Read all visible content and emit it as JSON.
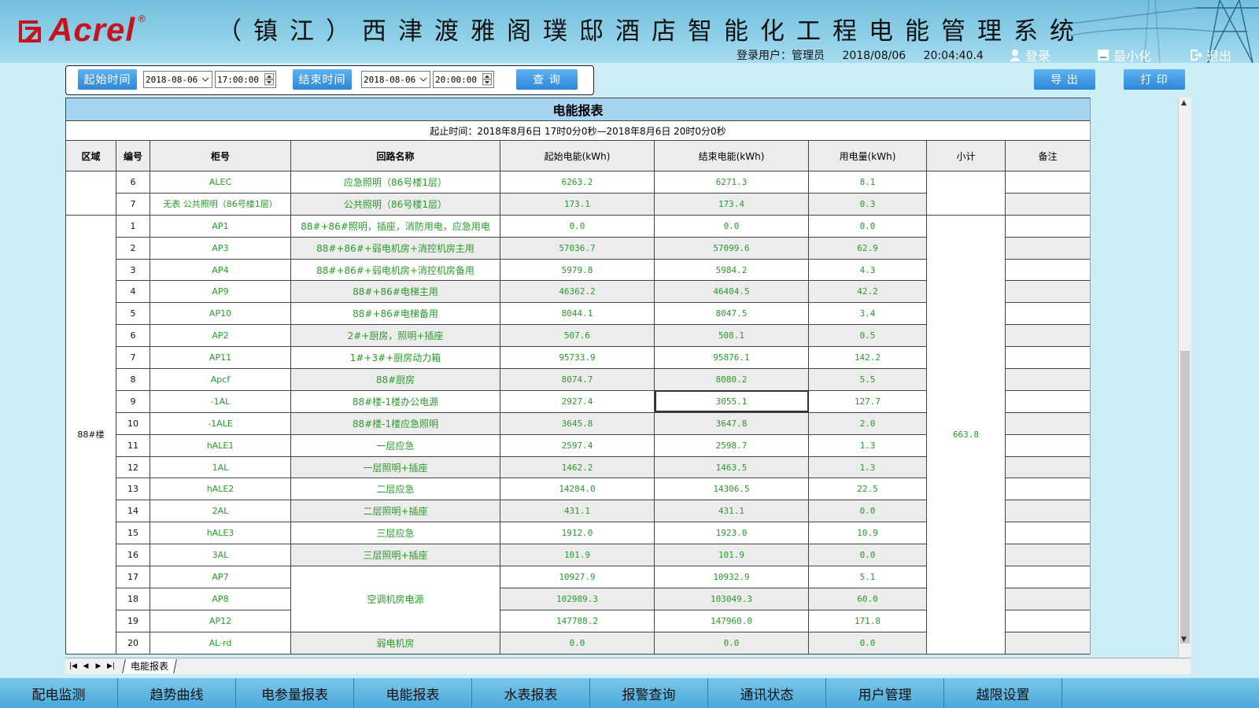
{
  "header": {
    "logo_text": "Acrel",
    "logo_reg": "®",
    "title": "（镇江）西津渡雅阁璞邸酒店智能化工程电能管理系统",
    "user_label": "登录用户：",
    "user_name": "管理员",
    "date": "2018/08/06",
    "time": "20:04:40.4",
    "login": "登录",
    "minimize": "最小化",
    "exit": "退出"
  },
  "toolbar": {
    "start_label": "起始时间",
    "start_date": "2018-08-06",
    "start_time": "17:00:00",
    "end_label": "结束时间",
    "end_date": "2018-08-06",
    "end_time": "20:00:00",
    "query": "查 询",
    "export": "导 出",
    "print": "打 印"
  },
  "report": {
    "title": "电能报表",
    "period": "起止时间：2018年8月6日 17时0分0秒—2018年8月6日 20时0分0秒",
    "columns": [
      "区域",
      "编号",
      "柜号",
      "回路名称",
      "起始电能(kWh)",
      "结束电能(kWh)",
      "用电量(kWh)",
      "小计",
      "备注"
    ],
    "group1": [
      {
        "no": "6",
        "cabinet": "ALEC",
        "circuit": "应急照明（86号楼1层）",
        "start": "6263.2",
        "end": "6271.3",
        "usage": "8.1"
      },
      {
        "no": "7",
        "cabinet": "无表 公共照明（86号楼1层）",
        "circuit": "公共照明（86号楼1层）",
        "start": "173.1",
        "end": "173.4",
        "usage": "0.3"
      }
    ],
    "group2_area": "88#楼",
    "group2_subtotal": "663.8",
    "group2": [
      {
        "no": "1",
        "cabinet": "AP1",
        "circuit": "88#+86#照明，插座，消防用电，应急用电",
        "start": "0.0",
        "end": "0.0",
        "usage": "0.0"
      },
      {
        "no": "2",
        "cabinet": "AP3",
        "circuit": "88#+86#+弱电机房+消控机房主用",
        "start": "57036.7",
        "end": "57099.6",
        "usage": "62.9"
      },
      {
        "no": "3",
        "cabinet": "AP4",
        "circuit": "88#+86#+弱电机房+消控机房备用",
        "start": "5979.8",
        "end": "5984.2",
        "usage": "4.3"
      },
      {
        "no": "4",
        "cabinet": "AP9",
        "circuit": "88#+86#电梯主用",
        "start": "46362.2",
        "end": "46404.5",
        "usage": "42.2"
      },
      {
        "no": "5",
        "cabinet": "AP10",
        "circuit": "88#+86#电梯备用",
        "start": "8044.1",
        "end": "8047.5",
        "usage": "3.4"
      },
      {
        "no": "6",
        "cabinet": "AP2",
        "circuit": "2#+厨房，照明+插座",
        "start": "507.6",
        "end": "508.1",
        "usage": "0.5"
      },
      {
        "no": "7",
        "cabinet": "AP11",
        "circuit": "1#+3#+厨房动力箱",
        "start": "95733.9",
        "end": "95876.1",
        "usage": "142.2"
      },
      {
        "no": "8",
        "cabinet": "Apcf",
        "circuit": "88#厨房",
        "start": "8074.7",
        "end": "8080.2",
        "usage": "5.5"
      },
      {
        "no": "9",
        "cabinet": "-1AL",
        "circuit": "88#楼-1楼办公电源",
        "start": "2927.4",
        "end": "3055.1",
        "usage": "127.7"
      },
      {
        "no": "10",
        "cabinet": "-1ALE",
        "circuit": "88#楼-1楼应急照明",
        "start": "3645.8",
        "end": "3647.8",
        "usage": "2.0"
      },
      {
        "no": "11",
        "cabinet": "hALE1",
        "circuit": "一层应急",
        "start": "2597.4",
        "end": "2598.7",
        "usage": "1.3"
      },
      {
        "no": "12",
        "cabinet": "1AL",
        "circuit": "一层照明+插座",
        "start": "1462.2",
        "end": "1463.5",
        "usage": "1.3"
      },
      {
        "no": "13",
        "cabinet": "hALE2",
        "circuit": "二层应急",
        "start": "14284.0",
        "end": "14306.5",
        "usage": "22.5"
      },
      {
        "no": "14",
        "cabinet": "2AL",
        "circuit": "二层照明+插座",
        "start": "431.1",
        "end": "431.1",
        "usage": "0.0"
      },
      {
        "no": "15",
        "cabinet": "hALE3",
        "circuit": "三层应急",
        "start": "1912.0",
        "end": "1923.0",
        "usage": "10.9"
      },
      {
        "no": "16",
        "cabinet": "3AL",
        "circuit": "三层照明+插座",
        "start": "101.9",
        "end": "101.9",
        "usage": "0.0"
      },
      {
        "no": "17",
        "cabinet": "AP7",
        "circuit": "",
        "start": "10927.9",
        "end": "10932.9",
        "usage": "5.1"
      },
      {
        "no": "18",
        "cabinet": "AP8",
        "circuit": "空调机房电源",
        "start": "102989.3",
        "end": "103049.3",
        "usage": "60.0"
      },
      {
        "no": "19",
        "cabinet": "AP12",
        "circuit": "",
        "start": "147788.2",
        "end": "147960.0",
        "usage": "171.8"
      },
      {
        "no": "20",
        "cabinet": "AL-rd",
        "circuit": "弱电机房",
        "start": "0.0",
        "end": "0.0",
        "usage": "0.0"
      }
    ]
  },
  "sheet_tab": "电能报表",
  "bottom_nav": [
    "配电监测",
    "趋势曲线",
    "电参量报表",
    "电能报表",
    "水表报表",
    "报警查询",
    "通讯状态",
    "用户管理",
    "越限设置"
  ]
}
